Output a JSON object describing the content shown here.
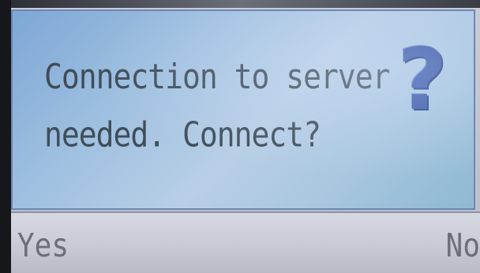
{
  "dialog": {
    "message": "Connection to server needed. Connect?",
    "icon": "question-mark-icon",
    "icon_glyph": "?"
  },
  "softkeys": {
    "left_label": "Yes",
    "right_label": "No"
  },
  "colors": {
    "dialog_background": "#9fc0e0",
    "icon": "#3a5aa8",
    "text": "#3f4d59",
    "softkey_bar": "#c6c8d3"
  }
}
